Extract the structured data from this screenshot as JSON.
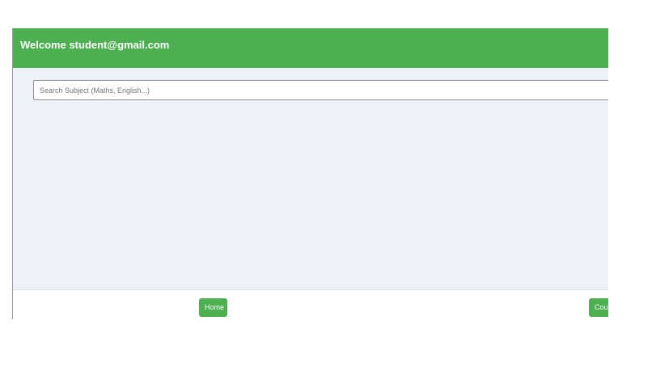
{
  "header": {
    "title": "Welcome student@gmail.com"
  },
  "search": {
    "placeholder": "Search Subject (Maths, English...)",
    "value": ""
  },
  "footer": {
    "home_label": "Home",
    "courses_label": "Courses"
  },
  "colors": {
    "accent": "#4caf50",
    "content_background": "#eef2f7"
  }
}
